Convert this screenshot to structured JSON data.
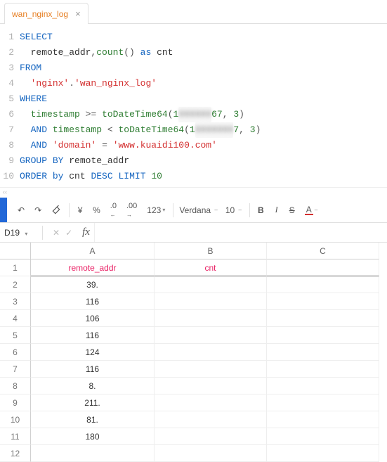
{
  "tab": {
    "title": "wan_nginx_log",
    "close": "×"
  },
  "code": {
    "lines": [
      [
        [
          "kw",
          "SELECT"
        ]
      ],
      [
        [
          "plain",
          "  remote_addr"
        ],
        [
          "punc",
          ","
        ],
        [
          "fn",
          "count"
        ],
        [
          "punc",
          "()"
        ],
        [
          "plain",
          " "
        ],
        [
          "kw",
          "as"
        ],
        [
          "plain",
          " cnt"
        ]
      ],
      [
        [
          "kw",
          "FROM"
        ]
      ],
      [
        [
          "plain",
          "  "
        ],
        [
          "str",
          "'nginx'"
        ],
        [
          "punc",
          "."
        ],
        [
          "str",
          "'wan_nginx_log'"
        ]
      ],
      [
        [
          "kw",
          "WHERE"
        ]
      ],
      [
        [
          "plain",
          "  "
        ],
        [
          "id",
          "timestamp"
        ],
        [
          "plain",
          " "
        ],
        [
          "punc",
          ">="
        ],
        [
          "plain",
          " "
        ],
        [
          "fn",
          "toDateTime64"
        ],
        [
          "punc",
          "("
        ],
        [
          "num",
          "1"
        ],
        [
          "blur",
          "000000"
        ],
        [
          "num",
          "67"
        ],
        [
          "punc",
          ","
        ],
        [
          "plain",
          " "
        ],
        [
          "num",
          "3"
        ],
        [
          "punc",
          ")"
        ]
      ],
      [
        [
          "plain",
          "  "
        ],
        [
          "kw",
          "AND"
        ],
        [
          "plain",
          " "
        ],
        [
          "id",
          "timestamp"
        ],
        [
          "plain",
          " "
        ],
        [
          "punc",
          "<"
        ],
        [
          "plain",
          " "
        ],
        [
          "fn",
          "toDateTime64"
        ],
        [
          "punc",
          "("
        ],
        [
          "num",
          "1"
        ],
        [
          "blur",
          "0000000"
        ],
        [
          "num",
          "7"
        ],
        [
          "punc",
          ","
        ],
        [
          "plain",
          " "
        ],
        [
          "num",
          "3"
        ],
        [
          "punc",
          ")"
        ]
      ],
      [
        [
          "plain",
          "  "
        ],
        [
          "kw",
          "AND"
        ],
        [
          "plain",
          " "
        ],
        [
          "str",
          "'domain'"
        ],
        [
          "plain",
          " "
        ],
        [
          "punc",
          "="
        ],
        [
          "plain",
          " "
        ],
        [
          "str",
          "'www.kuaidi100.com'"
        ]
      ],
      [
        [
          "kw",
          "GROUP"
        ],
        [
          "plain",
          " "
        ],
        [
          "kw",
          "BY"
        ],
        [
          "plain",
          " remote_addr"
        ]
      ],
      [
        [
          "kw",
          "ORDER"
        ],
        [
          "plain",
          " "
        ],
        [
          "kw",
          "by"
        ],
        [
          "plain",
          " cnt "
        ],
        [
          "kw",
          "DESC"
        ],
        [
          "plain",
          " "
        ],
        [
          "kw",
          "LIMIT"
        ],
        [
          "plain",
          " "
        ],
        [
          "num",
          "10"
        ]
      ]
    ]
  },
  "toolbar": {
    "undo": "↶",
    "redo": "↷",
    "paint": "🖌",
    "currency": "¥",
    "percent": "%",
    "dec_dec": ".0",
    "inc_dec": ".00",
    "num123": "123",
    "font": "Verdana",
    "size": "10",
    "bold": "B",
    "italic": "I",
    "strike": "S",
    "color": "A",
    "dd": "▾",
    "dash": "‒"
  },
  "namebox": {
    "ref": "D19",
    "dd": "▾",
    "cancel": "✕",
    "confirm": "✓",
    "fx": "fx"
  },
  "sheet": {
    "colA": "A",
    "colB": "B",
    "colC": "C",
    "rows": [
      {
        "n": "1",
        "a": "remote_addr",
        "b": "cnt",
        "header": true
      },
      {
        "n": "2",
        "a": "39.",
        "b": ""
      },
      {
        "n": "3",
        "a": "116",
        "b": ""
      },
      {
        "n": "4",
        "a": "106",
        "b": ""
      },
      {
        "n": "5",
        "a": "116",
        "b": ""
      },
      {
        "n": "6",
        "a": "124",
        "b": ""
      },
      {
        "n": "7",
        "a": "116",
        "b": ""
      },
      {
        "n": "8",
        "a": "8.",
        "b": ""
      },
      {
        "n": "9",
        "a": "211.",
        "b": ""
      },
      {
        "n": "10",
        "a": "81.",
        "b": ""
      },
      {
        "n": "11",
        "a": "180",
        "b": ""
      },
      {
        "n": "12",
        "a": "",
        "b": ""
      }
    ]
  }
}
